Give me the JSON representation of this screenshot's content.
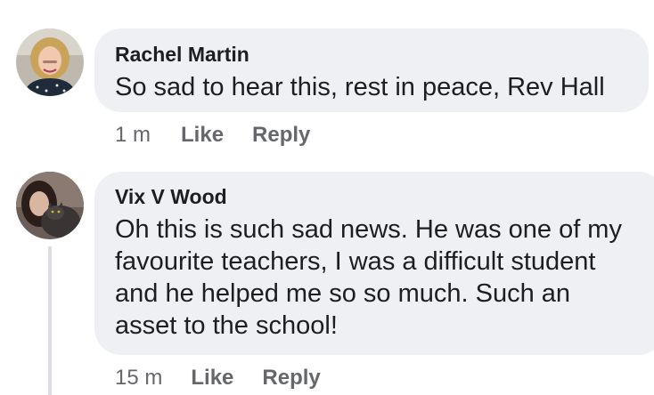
{
  "comments": [
    {
      "author": "Rachel Martin",
      "avatar_icon": "profile-photo-blonde-woman",
      "text": "So sad to hear this, rest in peace, Rev Hall",
      "time": "1 m",
      "like_label": "Like",
      "reply_label": "Reply"
    },
    {
      "author": "Vix V Wood",
      "avatar_icon": "profile-photo-woman-with-cat",
      "text_lines": [
        "Oh this is such sad news. He was one of my",
        "favourite teachers, I was a difficult student",
        "and he helped me so so much. Such an",
        "asset to the school!"
      ],
      "time": "15 m",
      "like_label": "Like",
      "reply_label": "Reply"
    }
  ],
  "colors": {
    "bubble": "#eff0f3",
    "text": "#1c1e21",
    "meta": "#65676b",
    "thread_line": "#dcdde1"
  }
}
